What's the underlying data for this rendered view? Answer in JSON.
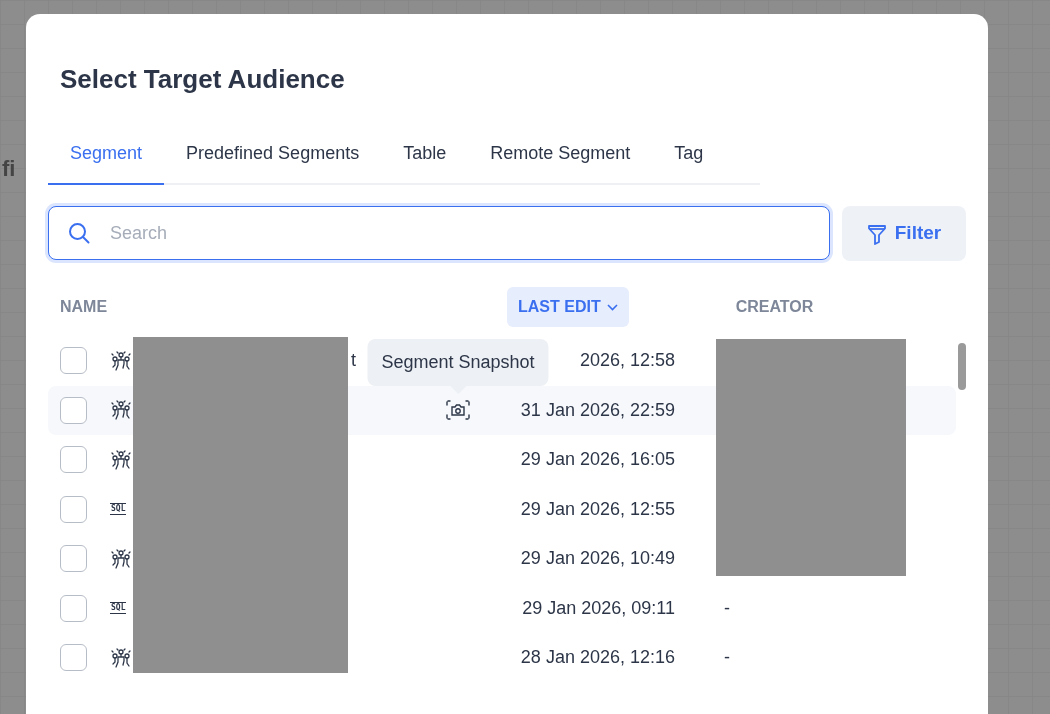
{
  "background": {
    "text": "fi"
  },
  "dialog": {
    "title": "Select Target Audience"
  },
  "tabs": [
    {
      "label": "Segment",
      "selected": true
    },
    {
      "label": "Predefined Segments",
      "selected": false
    },
    {
      "label": "Table",
      "selected": false
    },
    {
      "label": "Remote Segment",
      "selected": false
    },
    {
      "label": "Tag",
      "selected": false
    }
  ],
  "search": {
    "placeholder": "Search"
  },
  "filter_button": {
    "label": "Filter"
  },
  "table": {
    "columns": [
      {
        "label": "NAME",
        "sorted": false
      },
      {
        "label": "LAST EDIT",
        "sorted": true
      },
      {
        "label": "CREATOR",
        "sorted": false
      }
    ],
    "rows": [
      {
        "kind": "segment",
        "checked": false,
        "hovered": false,
        "name": "t",
        "last_edit": "2026, 12:58"
      },
      {
        "kind": "segment",
        "checked": false,
        "hovered": true,
        "last_edit": "31 Jan 2026, 22:59"
      },
      {
        "kind": "segment",
        "checked": false,
        "hovered": false,
        "last_edit": "29 Jan 2026, 16:05"
      },
      {
        "kind": "sql",
        "icon_text": "SQL",
        "checked": false,
        "hovered": false,
        "last_edit": "29 Jan 2026, 12:55"
      },
      {
        "kind": "segment",
        "checked": false,
        "hovered": false,
        "last_edit": "29 Jan 2026, 10:49"
      },
      {
        "kind": "sql",
        "icon_text": "SQL",
        "checked": false,
        "hovered": false,
        "last_edit": "29 Jan 2026, 09:11",
        "creator": "-"
      },
      {
        "kind": "segment",
        "checked": false,
        "hovered": false,
        "last_edit": "28 Jan 2026, 12:16",
        "creator": "-"
      }
    ]
  },
  "tooltip": {
    "text": "Segment Snapshot"
  }
}
